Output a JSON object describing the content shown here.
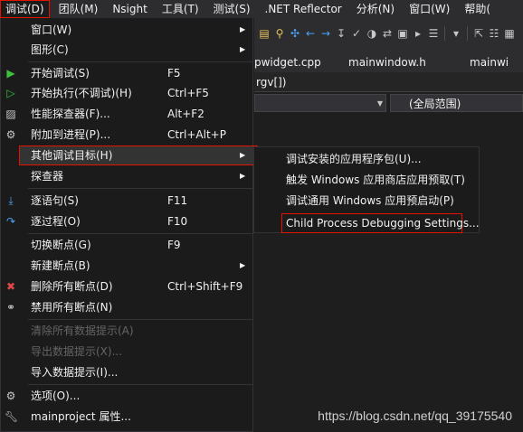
{
  "menubar": {
    "items": [
      "调试(D)",
      "团队(M)",
      "Nsight",
      "工具(T)",
      "测试(S)",
      ".NET Reflector",
      "分析(N)",
      "窗口(W)",
      "帮助("
    ]
  },
  "tabs": [
    "pwidget.cpp",
    "mainwindow.h",
    "mainwi"
  ],
  "editor": {
    "nav_text": "rgv[])",
    "scope_label": "(全局范围)"
  },
  "debug_menu": {
    "items": [
      {
        "label": "窗口(W)",
        "submenu": true
      },
      {
        "label": "图形(C)",
        "submenu": true
      },
      {
        "label": "开始调试(S)",
        "shortcut": "F5",
        "icon": "play-icon"
      },
      {
        "label": "开始执行(不调试)(H)",
        "shortcut": "Ctrl+F5",
        "icon": "play-outline-icon"
      },
      {
        "label": "性能探查器(F)...",
        "shortcut": "Alt+F2",
        "icon": "performance-icon"
      },
      {
        "label": "附加到进程(P)...",
        "shortcut": "Ctrl+Alt+P",
        "icon": "attach-process-icon"
      },
      {
        "label": "其他调试目标(H)",
        "submenu": true,
        "highlighted": true
      },
      {
        "label": "探查器",
        "submenu": true
      },
      {
        "label": "逐语句(S)",
        "shortcut": "F11",
        "icon": "step-into-icon"
      },
      {
        "label": "逐过程(O)",
        "shortcut": "F10",
        "icon": "step-over-icon"
      },
      {
        "label": "切换断点(G)",
        "shortcut": "F9"
      },
      {
        "label": "新建断点(B)",
        "submenu": true
      },
      {
        "label": "删除所有断点(D)",
        "shortcut": "Ctrl+Shift+F9",
        "icon": "delete-breakpoints-icon"
      },
      {
        "label": "禁用所有断点(N)",
        "icon": "disable-breakpoints-icon"
      },
      {
        "label": "清除所有数据提示(A)",
        "disabled": true
      },
      {
        "label": "导出数据提示(X)...",
        "disabled": true
      },
      {
        "label": "导入数据提示(I)..."
      },
      {
        "label": "选项(O)...",
        "icon": "gear-icon"
      },
      {
        "label": "mainproject 属性...",
        "icon": "wrench-icon"
      }
    ]
  },
  "other_targets_submenu": {
    "items": [
      "调试安装的应用程序包(U)...",
      "触发 Windows 应用商店应用预取(T)",
      "调试通用 Windows 应用预启动(P)",
      "Child Process Debugging Settings..."
    ]
  },
  "watermark": "https://blog.csdn.net/qq_39175540",
  "colors": {
    "highlight_border": "#e51400",
    "menu_bg": "#1b1b1c",
    "menubar_bg": "#2d2d30",
    "editor_bg": "#1e1e1e"
  }
}
